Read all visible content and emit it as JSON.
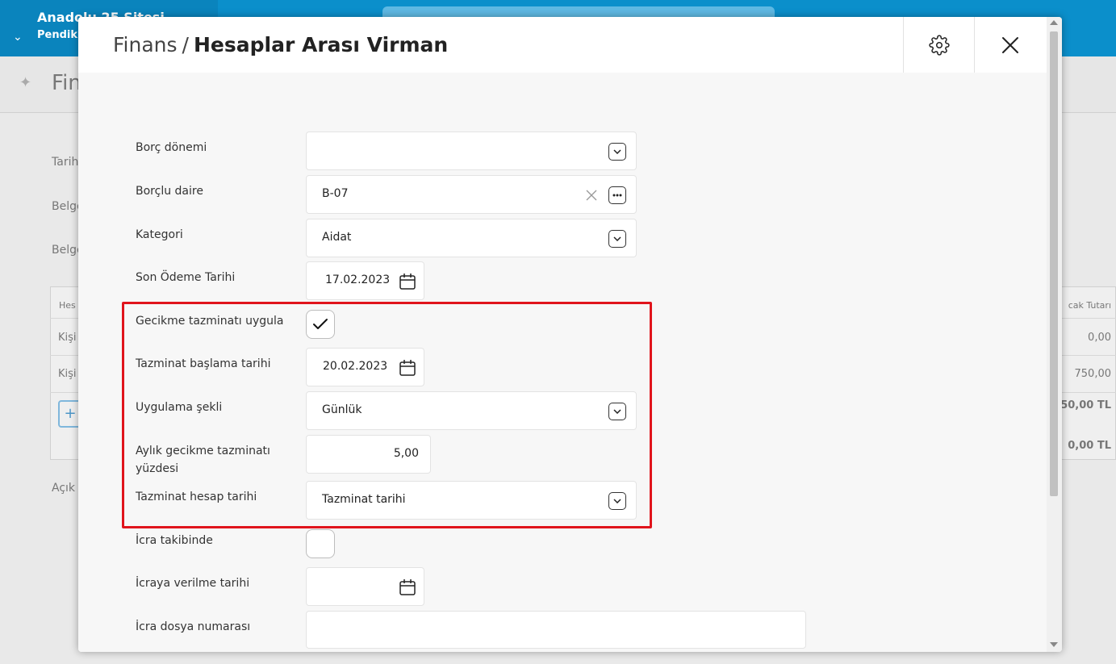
{
  "background": {
    "app_name": "Anadolu 25 Sitesi",
    "app_subtitle": "Pendik",
    "page_title": "Finans",
    "labels": [
      "Tarih",
      "Belge",
      "Belge",
      "Açık"
    ],
    "table_header_left": "Hes",
    "table_header_right": "cak Tutarı",
    "rows": [
      {
        "left": "Kişi",
        "right": "0,00"
      },
      {
        "left": "Kişi",
        "right": "750,00"
      }
    ],
    "total_1": "50,00 TL",
    "total_2": "0,00 TL",
    "add_symbol": "+"
  },
  "modal": {
    "breadcrumb": "Finans",
    "separator": "/",
    "title": "Hesaplar Arası Virman",
    "settings_icon": "gear-icon",
    "close_icon": "close-icon"
  },
  "form": {
    "borc_donemi": {
      "label": "Borç dönemi",
      "value": ""
    },
    "borclu_daire": {
      "label": "Borçlu daire",
      "value": "B-07"
    },
    "kategori": {
      "label": "Kategori",
      "value": "Aidat"
    },
    "son_odeme_tarihi": {
      "label": "Son Ödeme Tarihi",
      "value": "17.02.2023"
    },
    "gecikme_tazminati_uygula": {
      "label": "Gecikme tazminatı uygula",
      "checked": true
    },
    "tazminat_baslama_tarihi": {
      "label": "Tazminat başlama tarihi",
      "value": "20.02.2023"
    },
    "uygulama_sekli": {
      "label": "Uygulama şekli",
      "value": "Günlük"
    },
    "aylik_gecikme_yuzdesi": {
      "label_line1": "Aylık gecikme tazminatı",
      "label_line2": "yüzdesi",
      "value": "5,00"
    },
    "tazminat_hesap_tarihi": {
      "label": "Tazminat hesap tarihi",
      "value": "Tazminat tarihi"
    },
    "icra_takibinde": {
      "label": "İcra takibinde",
      "checked": false
    },
    "icraya_verilme_tarihi": {
      "label": "İcraya verilme tarihi",
      "value": ""
    },
    "icra_dosya_numarasi": {
      "label": "İcra dosya numarası",
      "value": ""
    }
  },
  "colors": {
    "highlight": "#e0141c",
    "topbar": "#0b8fcb"
  }
}
